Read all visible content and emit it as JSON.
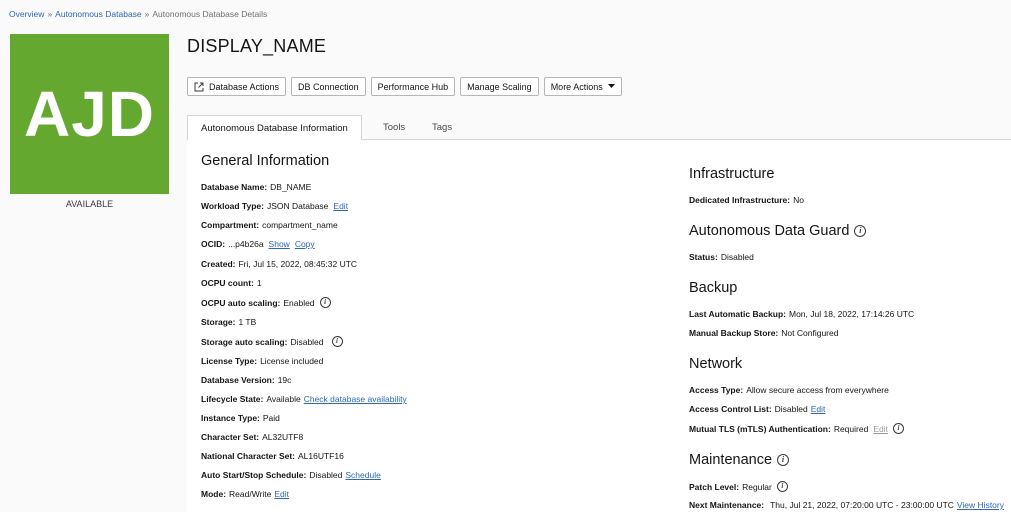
{
  "breadcrumb": {
    "items": [
      "Overview",
      "Autonomous Database",
      "Autonomous Database Details"
    ],
    "separator": "»"
  },
  "tile": {
    "text": "AJD",
    "status": "AVAILABLE",
    "color": "#65a830"
  },
  "title": "DISPLAY_NAME",
  "toolbar": {
    "database_actions": "Database Actions",
    "db_connection": "DB Connection",
    "performance_hub": "Performance Hub",
    "manage_scaling": "Manage Scaling",
    "more_actions": "More Actions"
  },
  "tabs": [
    "Autonomous Database Information",
    "Tools",
    "Tags"
  ],
  "general": {
    "title": "General Information",
    "fields": [
      {
        "key": "Database Name:",
        "value": "DB_NAME"
      },
      {
        "key": "Workload Type:",
        "value": "JSON Database",
        "link": "Edit"
      },
      {
        "key": "Compartment:",
        "value": "compartment_name"
      },
      {
        "key": "OCID:",
        "value": "...p4b26a",
        "link": "Show",
        "link2": "Copy"
      },
      {
        "key": "Created:",
        "value": "Fri, Jul 15, 2022, 08:45:32 UTC"
      },
      {
        "key": "OCPU count:",
        "value": "1"
      },
      {
        "key": "OCPU auto scaling:",
        "value": "Enabled",
        "info": true
      },
      {
        "key": "Storage:",
        "value": "1 TB"
      },
      {
        "key": "Storage auto scaling:",
        "value": "Disabled",
        "info": true
      },
      {
        "key": "License Type:",
        "value": "License included"
      },
      {
        "key": "Database Version:",
        "value": "19c"
      },
      {
        "key": "Lifecycle State:",
        "value": "Available",
        "link": "Check database availability"
      },
      {
        "key": "Instance Type:",
        "value": "Paid"
      },
      {
        "key": "Character Set:",
        "value": "AL32UTF8"
      },
      {
        "key": "National Character Set:",
        "value": "AL16UTF16"
      },
      {
        "key": "Auto Start/Stop Schedule:",
        "value": "Disabled",
        "link": "Schedule"
      },
      {
        "key": "Mode:",
        "value": "Read/Write",
        "link": "Edit"
      }
    ]
  },
  "infrastructure": {
    "title": "Infrastructure",
    "fields": [
      {
        "key": "Dedicated Infrastructure:",
        "value": "No"
      }
    ]
  },
  "data_guard": {
    "title": "Autonomous Data Guard",
    "fields": [
      {
        "key": "Status:",
        "value": "Disabled"
      }
    ]
  },
  "backup": {
    "title": "Backup",
    "fields": [
      {
        "key": "Last Automatic Backup:",
        "value": "Mon, Jul 18, 2022, 17:14:26 UTC"
      },
      {
        "key": "Manual Backup Store:",
        "value": "Not Configured"
      }
    ]
  },
  "network": {
    "title": "Network",
    "fields": [
      {
        "key": "Access Type:",
        "value": "Allow secure access from everywhere"
      },
      {
        "key": "Access Control List:",
        "value": "Disabled",
        "link": "Edit"
      },
      {
        "key": "Mutual TLS (mTLS) Authentication:",
        "value": "Required",
        "link": "Edit",
        "info": true
      }
    ]
  },
  "maintenance": {
    "title": "Maintenance",
    "fields": [
      {
        "key": "Patch Level:",
        "value": "Regular",
        "info": true
      },
      {
        "key": "Next Maintenance:",
        "value": "Thu, Jul 21, 2022, 07:20:00 UTC - 23:00:00 UTC",
        "link": "View History"
      }
    ]
  },
  "colors": {
    "link": "#2e67b1",
    "tile": "#65a830"
  }
}
